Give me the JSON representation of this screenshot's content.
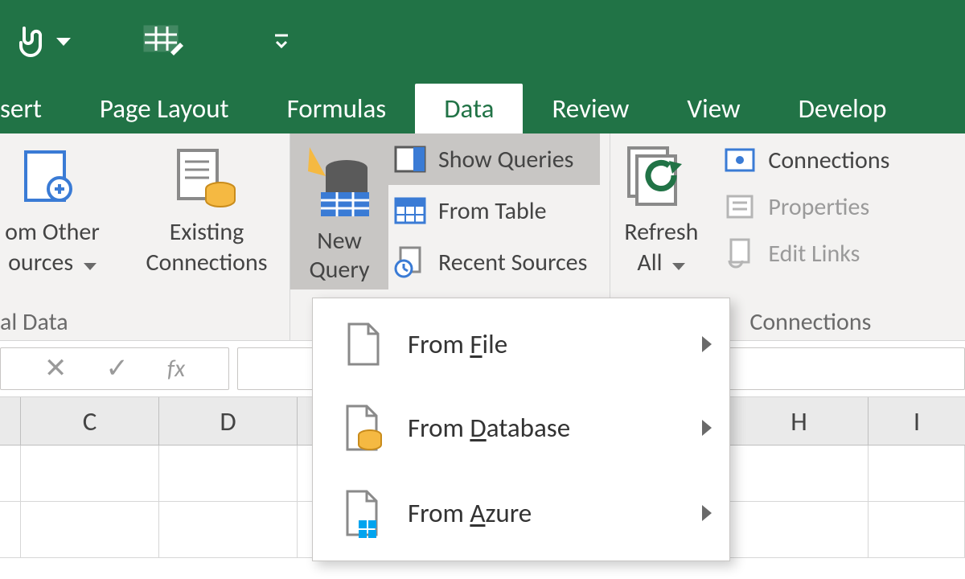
{
  "qat": {
    "touch_mode": "touch-mouse-mode",
    "customize": "customize-qat"
  },
  "tabs": {
    "insert": "sert",
    "page_layout": "Page Layout",
    "formulas": "Formulas",
    "data": "Data",
    "review": "Review",
    "view": "View",
    "developer": "Develop"
  },
  "ribbon": {
    "external": {
      "from_other_label_1": "om Other",
      "from_other_label_2": "ources",
      "existing_conn_label_1": "Existing",
      "existing_conn_label_2": "Connections",
      "group_label": "al Data"
    },
    "get_transform": {
      "new_query_1": "New",
      "new_query_2": "Query",
      "show_queries": "Show Queries",
      "from_table": "From Table",
      "recent_sources": "Recent Sources"
    },
    "refresh": {
      "label_1": "Refresh",
      "label_2": "All"
    },
    "connections": {
      "connections": "Connections",
      "properties": "Properties",
      "edit_links": "Edit Links",
      "group_label": "Connections"
    },
    "menu": {
      "from_file_pre": "From ",
      "from_file_u": "F",
      "from_file_post": "ile",
      "from_db_pre": "From ",
      "from_db_u": "D",
      "from_db_post": "atabase",
      "from_azure_pre": "From ",
      "from_azure_u": "A",
      "from_azure_post": "zure"
    }
  },
  "formula_bar": {
    "fx": "fx"
  },
  "columns": {
    "c": "C",
    "d": "D",
    "h": "H",
    "i": "I"
  }
}
